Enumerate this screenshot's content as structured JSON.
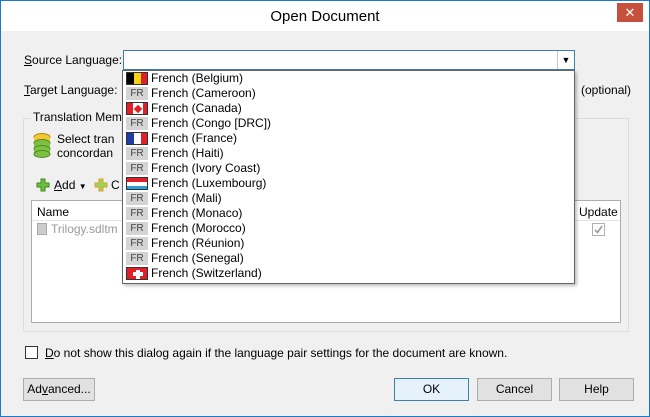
{
  "window": {
    "title": "Open Document",
    "close_glyph": "✕"
  },
  "form": {
    "source_label_u": "S",
    "source_label_rest": "ource Language:",
    "target_label_u": "T",
    "target_label_rest": "arget Language:",
    "optional": "(optional)"
  },
  "tm_group": {
    "title": "Translation Memory",
    "desc_line1": "Select tran",
    "desc_line2": "concordan",
    "add_label_u": "A",
    "add_label_rest": "dd",
    "second_btn_prefix": "C",
    "col_name": "Name",
    "col_update": "Update",
    "row_name": "Trilogy.sdltm"
  },
  "dropdown": {
    "items": [
      {
        "label": "French (Belgium)",
        "flag": "belgium"
      },
      {
        "label": "French (Cameroon)",
        "flag": "FR"
      },
      {
        "label": "French (Canada)",
        "flag": "canada"
      },
      {
        "label": "French (Congo [DRC])",
        "flag": "FR"
      },
      {
        "label": "French (France)",
        "flag": "france"
      },
      {
        "label": "French (Haiti)",
        "flag": "FR"
      },
      {
        "label": "French (Ivory Coast)",
        "flag": "FR"
      },
      {
        "label": "French (Luxembourg)",
        "flag": "luxembourg"
      },
      {
        "label": "French (Mali)",
        "flag": "FR"
      },
      {
        "label": "French (Monaco)",
        "flag": "FR"
      },
      {
        "label": "French (Morocco)",
        "flag": "FR"
      },
      {
        "label": "French (Réunion)",
        "flag": "FR"
      },
      {
        "label": "French (Senegal)",
        "flag": "FR"
      },
      {
        "label": "French (Switzerland)",
        "flag": "switzerland"
      }
    ]
  },
  "footer": {
    "dont_show_u": "D",
    "dont_show_rest": "o not show this dialog again if the language pair settings for the document are known.",
    "advanced_u": "v",
    "advanced_pre": "Ad",
    "advanced_post": "anced...",
    "ok": "OK",
    "cancel": "Cancel",
    "help": "Help"
  },
  "colors": {
    "accent": "#1979ca",
    "close": "#c7503d",
    "focus_border": "#3c7fb1"
  }
}
